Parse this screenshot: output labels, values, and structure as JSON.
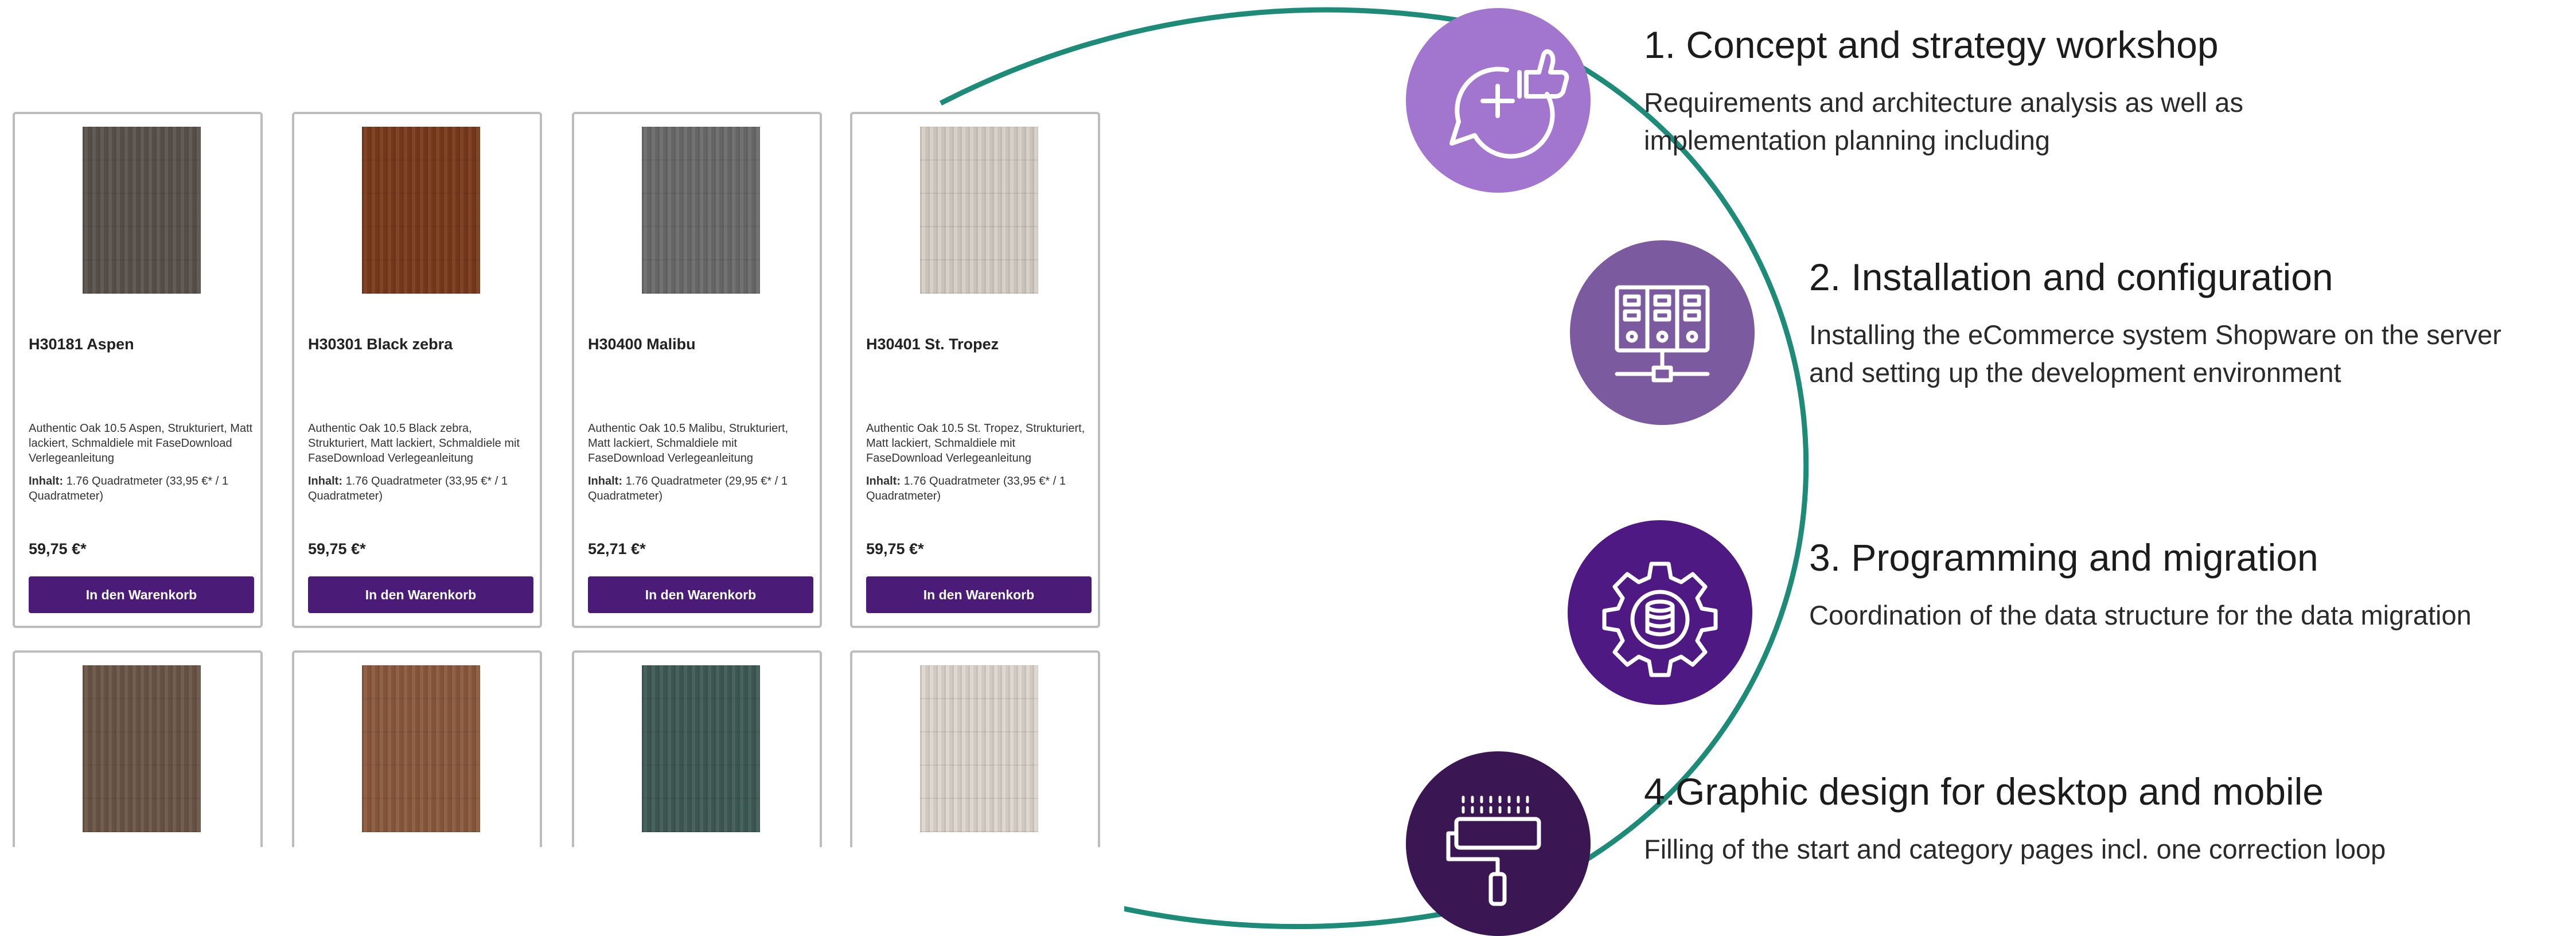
{
  "colors": {
    "arc": "#1e8a78",
    "button": "#4a1c78",
    "step1": "#a276cf",
    "step2": "#7b5a9f",
    "step3": "#4f1983",
    "step4": "#3a1752"
  },
  "products": [
    {
      "name": "H30181 Aspen",
      "description": "Authentic Oak 10.5 Aspen, Strukturiert, Matt lackiert, Schmaldiele mit FaseDownload Verlegeanleitung",
      "content_label": "Inhalt:",
      "content_text": "1.76 Quadratmeter (33,95 €* / 1 Quadratmeter)",
      "price": "59,75 €*",
      "button": "In den Warenkorb",
      "swatch": "#5a534c"
    },
    {
      "name": "H30301 Black zebra",
      "description": "Authentic Oak 10.5 Black zebra, Strukturiert, Matt lackiert, Schmaldiele mit FaseDownload Verlegeanleitung",
      "content_label": "Inhalt:",
      "content_text": "1.76 Quadratmeter (33,95 €* / 1 Quadratmeter)",
      "price": "59,75 €*",
      "button": "In den Warenkorb",
      "swatch": "#7a3a1c"
    },
    {
      "name": "H30400 Malibu",
      "description": "Authentic Oak 10.5 Malibu, Strukturiert, Matt lackiert, Schmaldiele mit FaseDownload Verlegeanleitung",
      "content_label": "Inhalt:",
      "content_text": "1.76 Quadratmeter (29,95 €* / 1 Quadratmeter)",
      "price": "52,71 €*",
      "button": "In den Warenkorb",
      "swatch": "#6c6b6b"
    },
    {
      "name": "H30401 St. Tropez",
      "description": "Authentic Oak 10.5 St. Tropez, Strukturiert, Matt lackiert, Schmaldiele mit FaseDownload Verlegeanleitung",
      "content_label": "Inhalt:",
      "content_text": "1.76 Quadratmeter (33,95 €* / 1 Quadratmeter)",
      "price": "59,75 €*",
      "button": "In den Warenkorb",
      "swatch": "#d6cfc6"
    }
  ],
  "products_row2": [
    {
      "swatch": "#6b5646"
    },
    {
      "swatch": "#8a5a3e"
    },
    {
      "swatch": "#3f5a55"
    },
    {
      "swatch": "#ddd6cd"
    }
  ],
  "steps": [
    {
      "title": "1. Concept and strategy workshop",
      "lines": [
        "Requirements and architecture analysis as well as",
        "implementation planning including"
      ],
      "icon": "chat-plus-thumbs-up-icon"
    },
    {
      "title": "2. Installation and configuration",
      "lines": [
        "Installing the eCommerce system Shopware on the server",
        "and setting up the development environment"
      ],
      "icon": "server-network-icon"
    },
    {
      "title": "3. Programming and migration",
      "lines": [
        "Coordination of the data structure for the data migration"
      ],
      "icon": "gear-database-icon"
    },
    {
      "title": "4.Graphic design for desktop and mobile",
      "lines": [
        "Filling of the start and category pages incl. one correction loop"
      ],
      "icon": "paint-roller-icon"
    }
  ]
}
